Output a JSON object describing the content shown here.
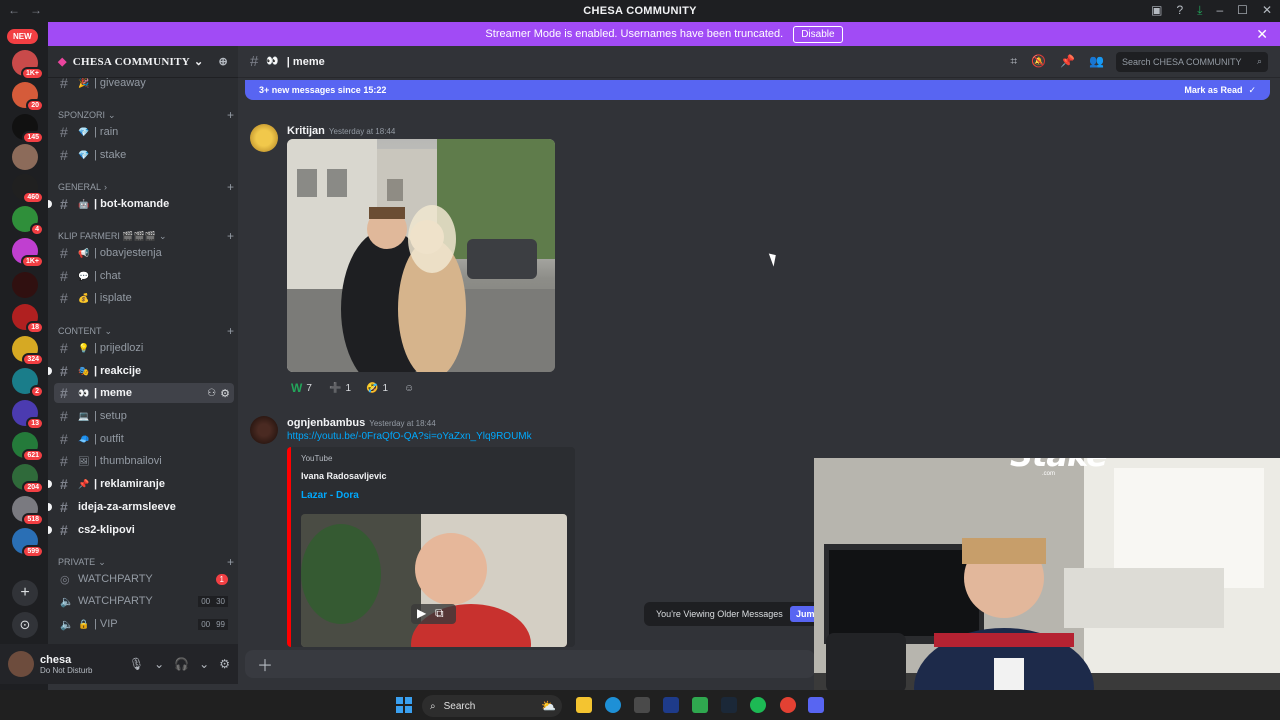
{
  "window": {
    "title": "CHESA COMMUNITY"
  },
  "banner": {
    "text": "Streamer Mode is enabled. Usernames have been truncated.",
    "button": "Disable"
  },
  "guilds": {
    "new_label": "NEW",
    "badges": [
      "1K+",
      "20",
      "145",
      "460",
      "4",
      "1K+",
      "18",
      "324",
      "2",
      "13",
      "621",
      "204",
      "518",
      "599"
    ]
  },
  "server": {
    "name": "CHESA COMMUNITY"
  },
  "sidebar": {
    "top_channel": {
      "emoji": "🎉",
      "name": "| giveaway"
    },
    "categories": [
      {
        "name": "SPONZORI",
        "channels": [
          {
            "emoji": "💎",
            "name": "| rain"
          },
          {
            "emoji": "💎",
            "name": "| stake"
          }
        ]
      },
      {
        "name": "GENERAL",
        "channels": [
          {
            "emoji": "🤖",
            "name": "| bot-komande"
          }
        ]
      },
      {
        "name": "KLIP FARMERI 🎬🎬🎬",
        "channels": [
          {
            "emoji": "📢",
            "name": "| obavjestenja"
          },
          {
            "emoji": "💬",
            "name": "| chat"
          },
          {
            "emoji": "💰",
            "name": "| isplate"
          }
        ]
      },
      {
        "name": "CONTENT",
        "channels": [
          {
            "emoji": "💡",
            "name": "| prijedlozi"
          },
          {
            "emoji": "🎭",
            "name": "| reakcije"
          },
          {
            "emoji": "👀",
            "name": "| meme"
          },
          {
            "emoji": "💻",
            "name": "| setup"
          },
          {
            "emoji": "🧢",
            "name": "| outfit"
          },
          {
            "emoji": "🖼",
            "name": "| thumbnailovi"
          },
          {
            "emoji": "📌",
            "name": "| reklamiranje"
          },
          {
            "emoji": "",
            "name": "ideja-za-armsleeve"
          },
          {
            "emoji": "",
            "name": "cs2-klipovi"
          }
        ]
      },
      {
        "name": "PRIVATE",
        "channels": [
          {
            "name": "WATCHPARTY",
            "badge": "1"
          },
          {
            "name": "WATCHPARTY",
            "count": [
              "00",
              "30"
            ]
          },
          {
            "emoji": "🔒",
            "name": "| VIP",
            "count": [
              "00",
              "99"
            ]
          }
        ]
      }
    ]
  },
  "user": {
    "name": "chesa",
    "status": "Do Not Disturb"
  },
  "channel": {
    "name": "| meme",
    "emoji": "👀",
    "search_placeholder": "Search CHESA COMMUNITY"
  },
  "new_messages": {
    "text": "3+ new messages since 15:22",
    "action": "Mark as Read"
  },
  "messages": [
    {
      "author": "Kritijan",
      "timestamp": "Yesterday at 18:44",
      "reactions": [
        {
          "emoji": "W",
          "count": "7"
        },
        {
          "emoji": "➕",
          "count": "1"
        },
        {
          "emoji": "🤣",
          "count": "1"
        },
        {
          "emoji": "☺",
          "count": ""
        }
      ]
    },
    {
      "author": "ognjenbambus",
      "timestamp": "Yesterday at 18:44",
      "link": "https://youtu.be/-0FraQfO-QA?si=oYaZxn_Ylq9ROUMk",
      "embed": {
        "provider": "YouTube",
        "author": "Ivana Radosavljevic",
        "title": "Lazar - Dora"
      }
    }
  ],
  "older_messages": {
    "text": "You're Viewing Older Messages",
    "jump": "Jum"
  },
  "overlay": {
    "logo": "Stake",
    "sub": ".com"
  },
  "taskbar": {
    "search": "Search"
  },
  "colors": {
    "accent": "#5865f2",
    "banner": "#a14bf5",
    "badge": "#f23f43"
  }
}
